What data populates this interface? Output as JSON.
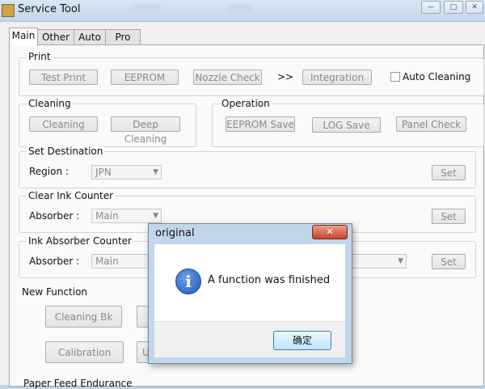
{
  "window": {
    "title": "Service Tool"
  },
  "tabs": [
    "Main",
    "Other",
    "Auto",
    "Pro"
  ],
  "print": {
    "label": "Print",
    "buttons": [
      "Test Print",
      "EEPROM",
      "Nozzle Check"
    ],
    "arrow": ">>",
    "integration": "Integration",
    "auto_cleaning": "Auto Cleaning"
  },
  "cleaning": {
    "label": "Cleaning",
    "buttons": [
      "Cleaning",
      "Deep Cleaning"
    ]
  },
  "operation": {
    "label": "Operation",
    "buttons": [
      "EEPROM Save",
      "LOG Save",
      "Panel Check"
    ]
  },
  "set_destination": {
    "label": "Set Destination",
    "field_label": "Region :",
    "value": "JPN",
    "set": "Set"
  },
  "clear_ink": {
    "label": "Clear Ink Counter",
    "field_label": "Absorber :",
    "value": "Main",
    "set": "Set"
  },
  "ink_absorber": {
    "label": "Ink Absorber Counter",
    "field_label": "Absorber :",
    "value": "Main",
    "set": "Set"
  },
  "new_function": {
    "label": "New Function",
    "buttons": [
      "Cleaning Bk",
      "Calibration"
    ],
    "truncated": [
      "U"
    ]
  },
  "paper_feed": {
    "label": "Paper Feed Endurance"
  },
  "dialog": {
    "title": "original",
    "message": "A function was finished",
    "ok": "确定"
  }
}
